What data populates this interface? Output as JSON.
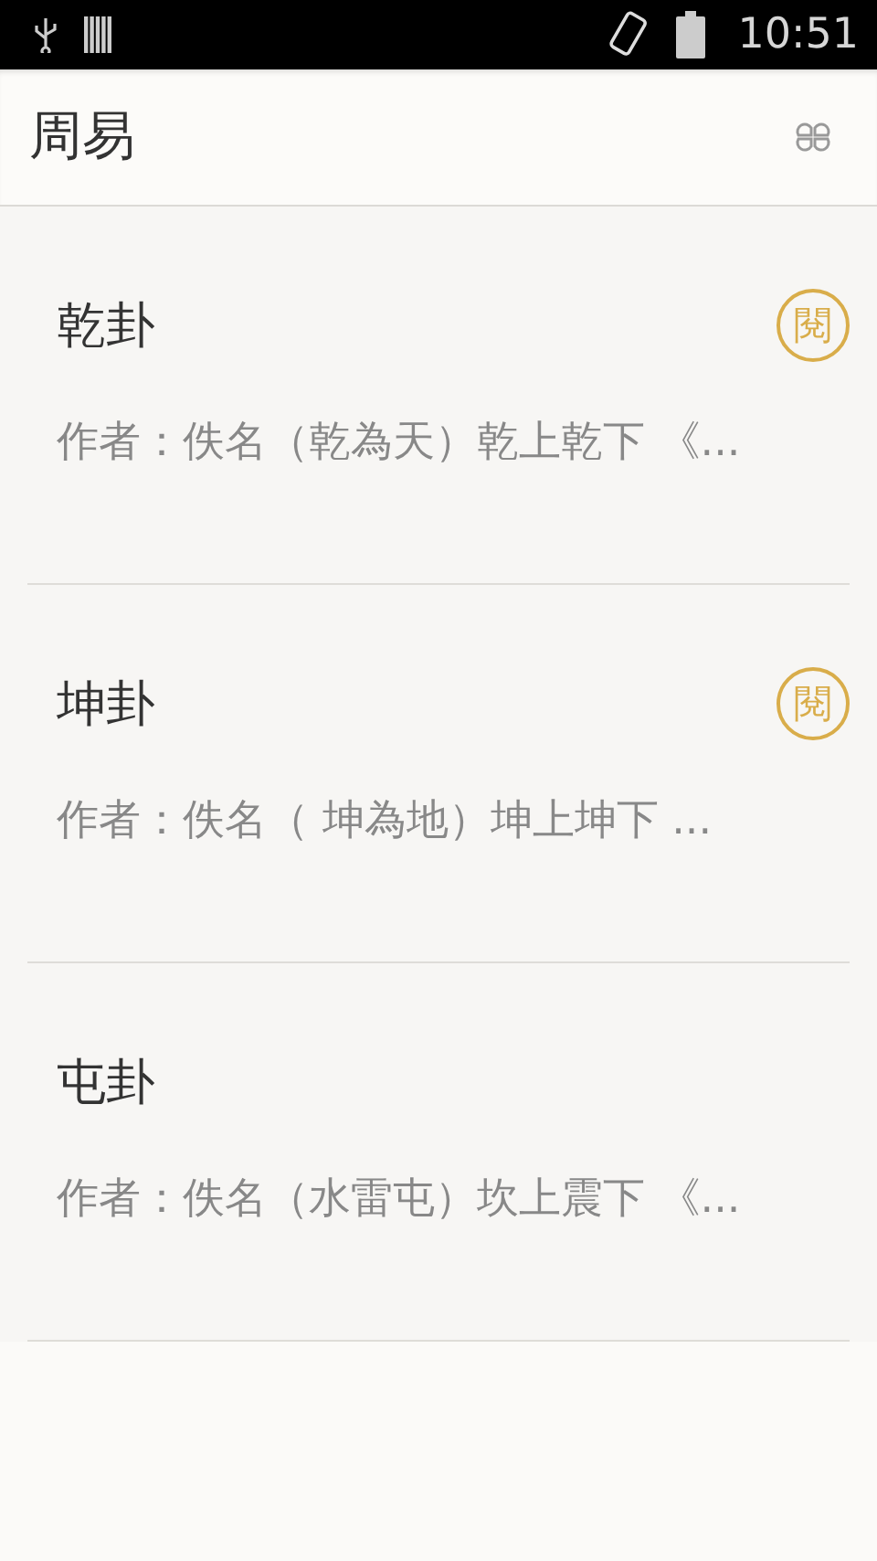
{
  "status_bar": {
    "time": "10:51"
  },
  "app_bar": {
    "title": "周易"
  },
  "items": [
    {
      "title": "乾卦",
      "badge": "閱",
      "description": "作者：佚名（乾為天）乾上乾下 《..."
    },
    {
      "title": "坤卦",
      "badge": "閱",
      "description": "作者：佚名（ 坤為地）坤上坤下 ..."
    },
    {
      "title": "屯卦",
      "description": "作者：佚名（水雷屯）坎上震下 《..."
    }
  ]
}
